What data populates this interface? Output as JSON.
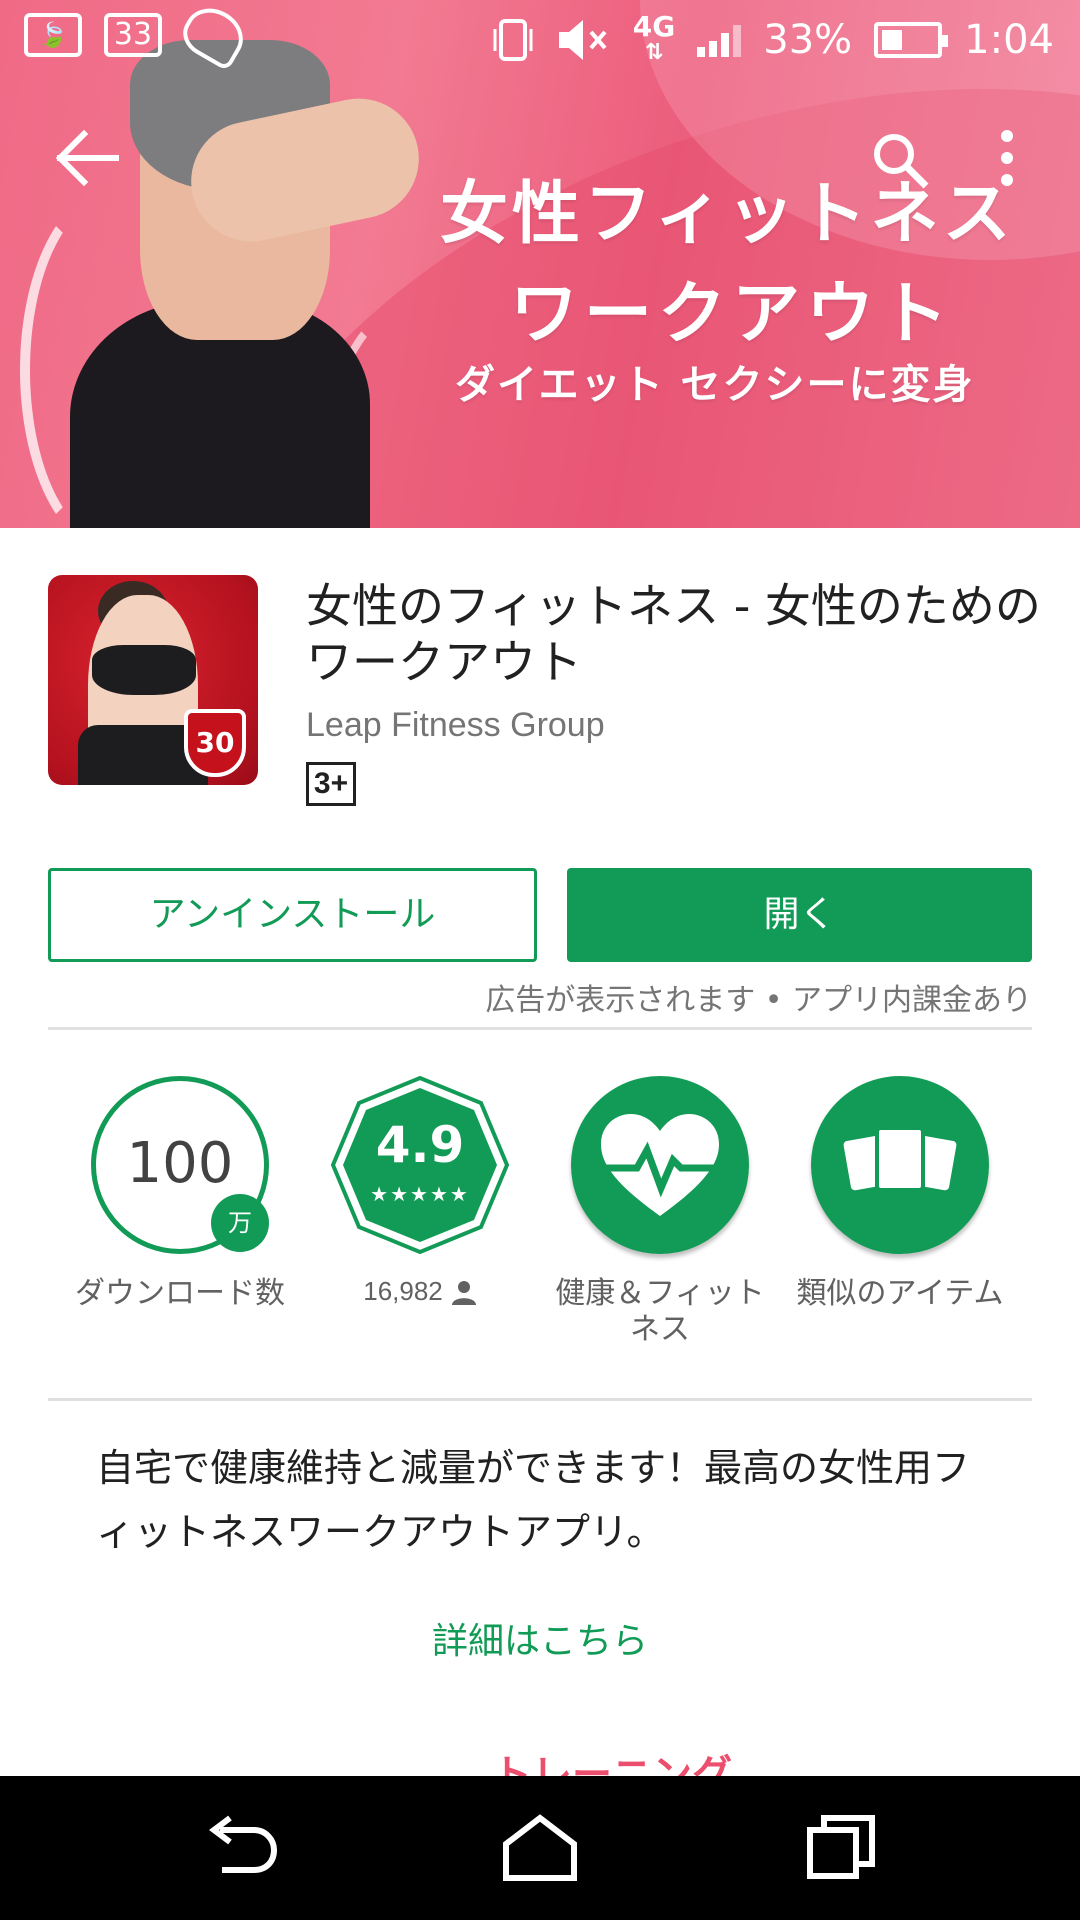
{
  "status_bar": {
    "notification_count": "33",
    "network_type": "4G",
    "battery_percent": "33%",
    "battery_level": 0.33,
    "time": "1:04",
    "icons": [
      "leaf-battery-icon",
      "notification-count-icon",
      "shoe-icon",
      "vibrate-icon",
      "mute-icon",
      "network-4g-icon",
      "signal-icon",
      "battery-icon"
    ]
  },
  "toolbar": {
    "back_icon": "arrow-back-icon",
    "search_icon": "search-icon",
    "more_icon": "more-vert-icon"
  },
  "hero": {
    "title_line1": "女性フィットネス",
    "title_line2": "ワークアウト",
    "subtitle": "ダイエット セクシーに変身",
    "colors": {
      "pink": "#f06a86",
      "deep_pink": "#e8506f"
    }
  },
  "app": {
    "title": "女性のフィットネス - 女性のためのワークアウト",
    "developer": "Leap Fitness Group",
    "content_rating": "3+",
    "icon_badge": "30"
  },
  "actions": {
    "uninstall_label": "アンインストール",
    "open_label": "開く",
    "ads_note": "広告が表示されます • アプリ内課金あり"
  },
  "stats": {
    "downloads_value": "100",
    "downloads_unit": "万",
    "downloads_label": "ダウンロード数",
    "rating_value": "4.9",
    "rating_stars": "★★★★★",
    "rating_count": "16,982",
    "category_label": "健康＆フィットネス",
    "similar_label": "類似のアイテム"
  },
  "description": {
    "text": "自宅で健康維持と減量ができます！最高の女性用フィットネスワークアウトアプリ。",
    "more_link": "詳細はこちら"
  },
  "screenshots_peek": {
    "item2": "トレーニング"
  },
  "theme": {
    "accent": "#129b56",
    "text_secondary": "#757575"
  }
}
